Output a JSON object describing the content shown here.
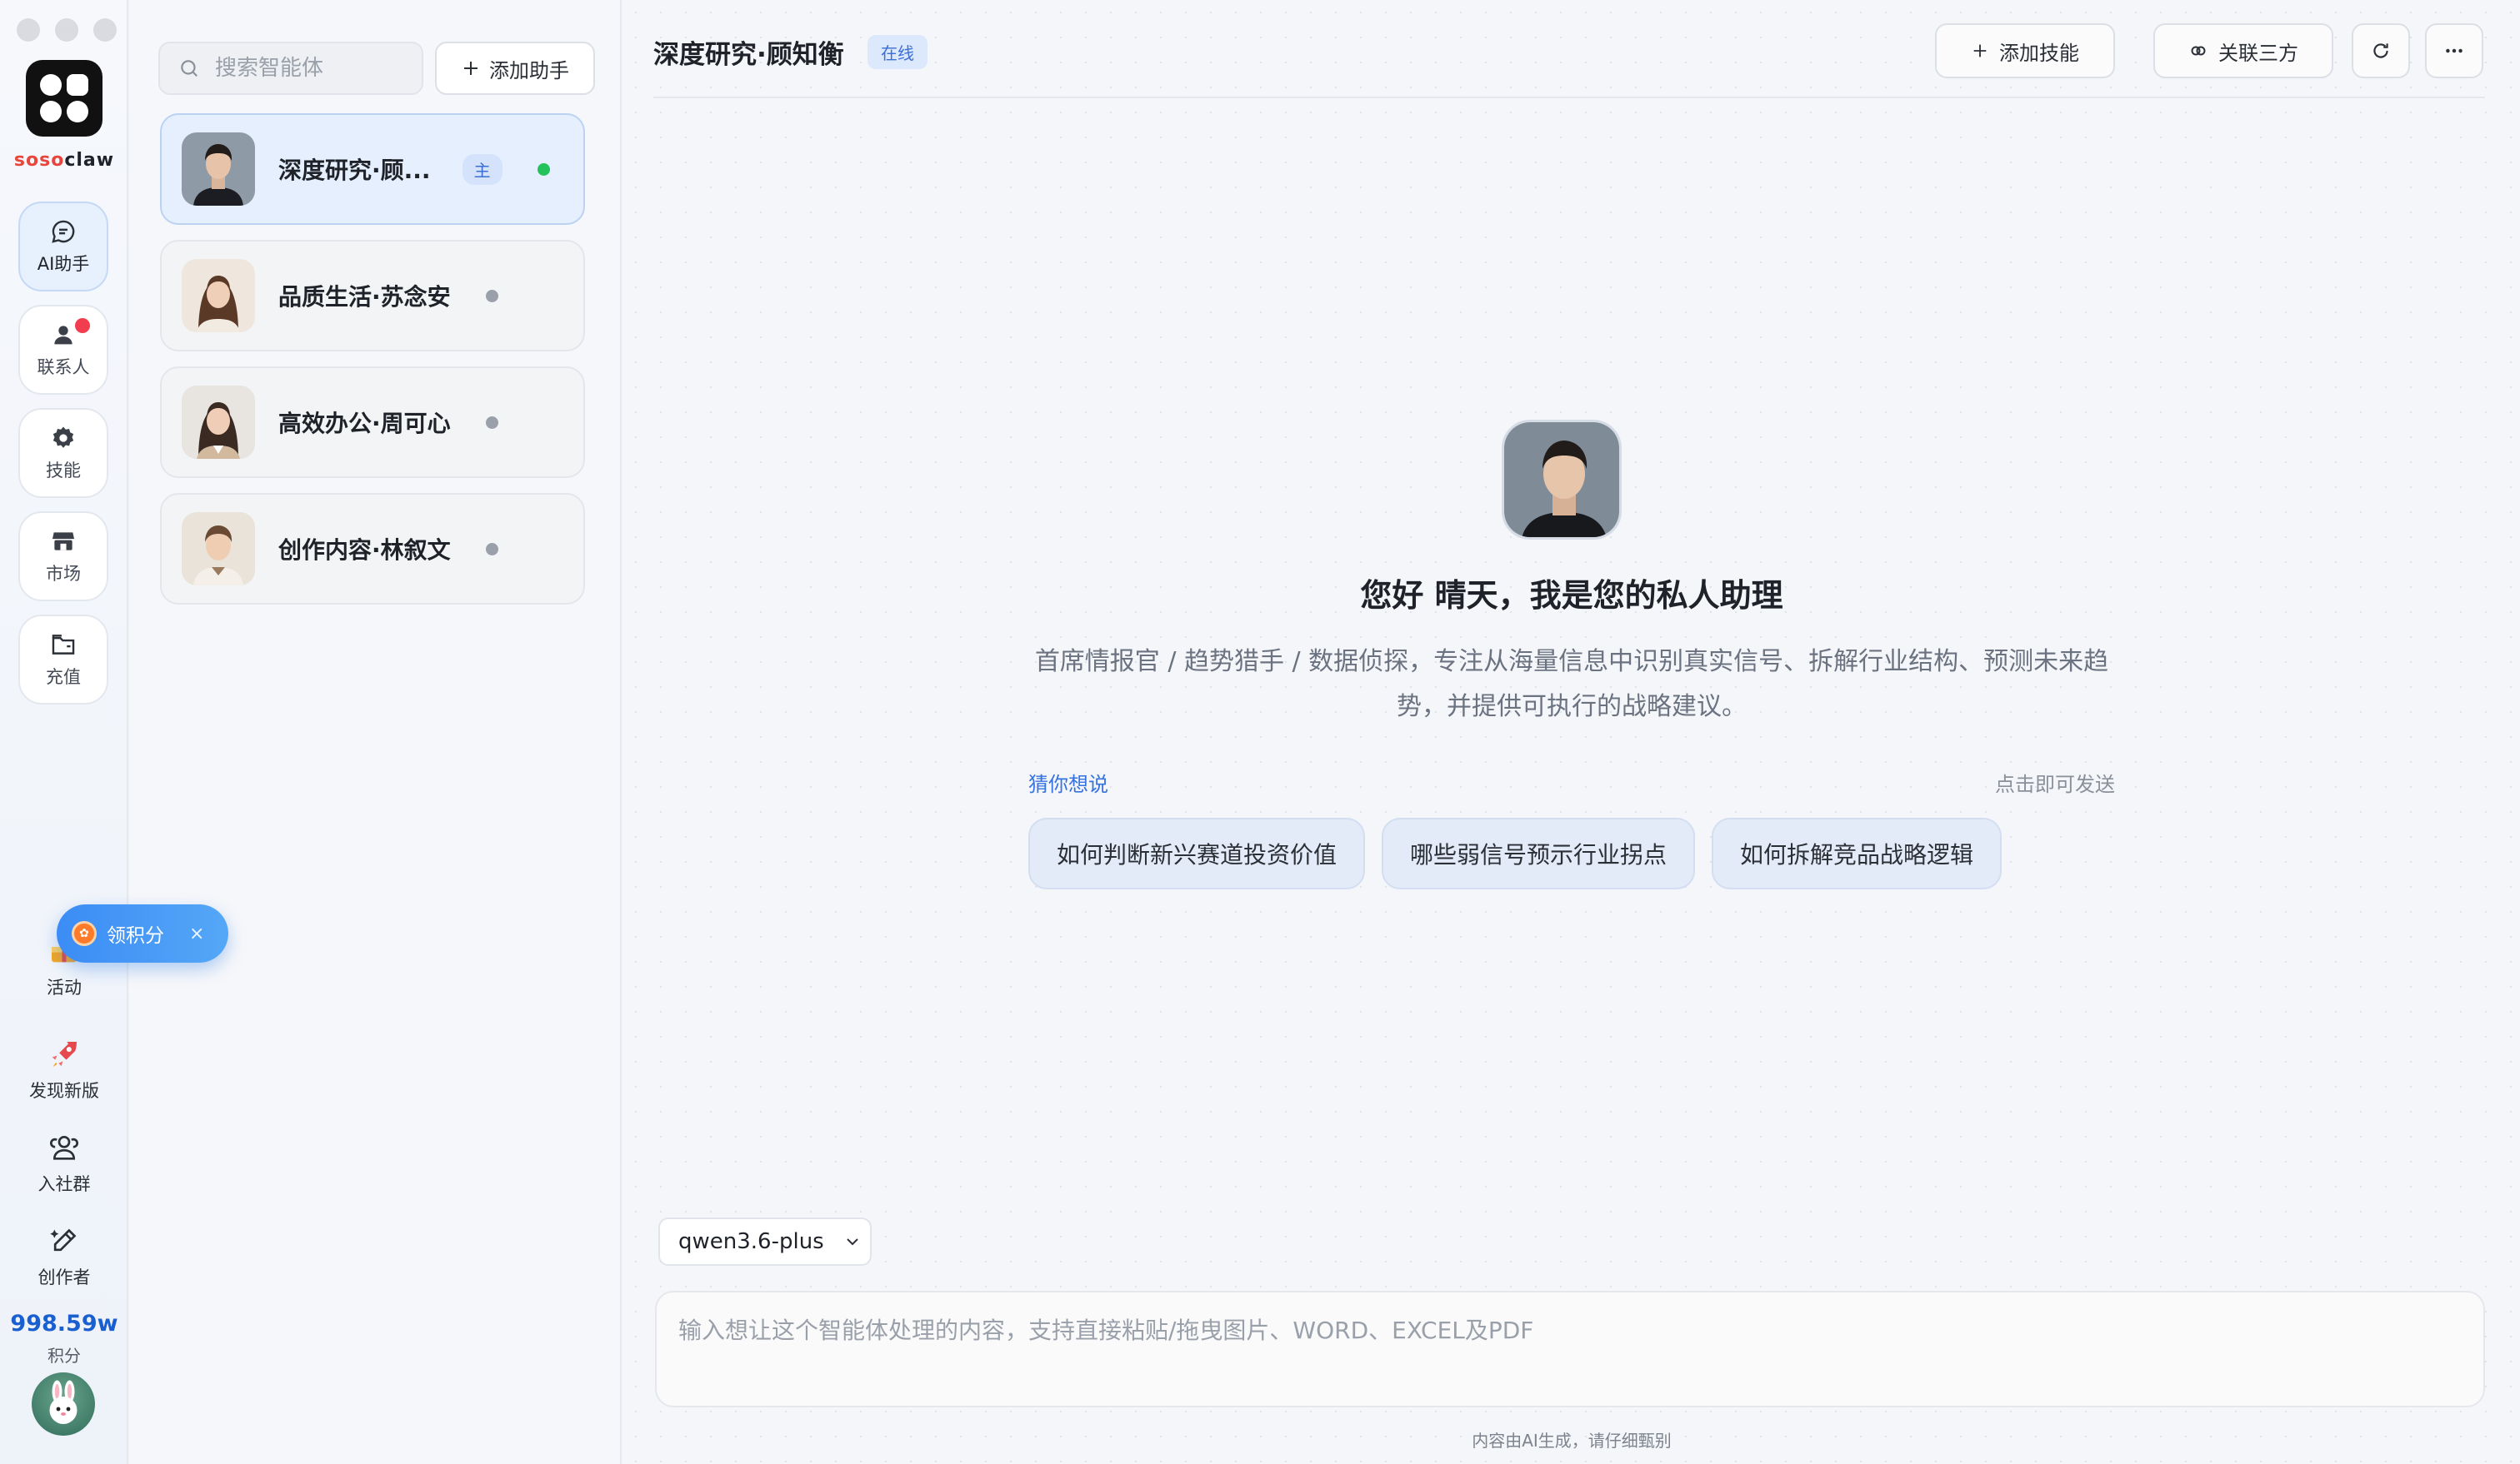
{
  "brand": {
    "logo_part1": "soso",
    "logo_part2": "claw"
  },
  "rail": {
    "items": [
      {
        "label": "AI助手",
        "icon": "chat-icon",
        "active": true
      },
      {
        "label": "联系人",
        "icon": "user-icon",
        "badge": true
      },
      {
        "label": "技能",
        "icon": "gear-icon"
      },
      {
        "label": "市场",
        "icon": "store-icon"
      },
      {
        "label": "充值",
        "icon": "wallet-icon"
      }
    ],
    "bottom": [
      {
        "label": "活动",
        "icon": "gift-icon"
      },
      {
        "label": "发现新版",
        "icon": "rocket-icon"
      },
      {
        "label": "入社群",
        "icon": "group-icon"
      },
      {
        "label": "创作者",
        "icon": "pen-icon"
      }
    ],
    "points_value": "998.59w",
    "points_label": "积分",
    "reward_label": "领积分",
    "reward_close": "×"
  },
  "sidebar": {
    "search_placeholder": "搜索智能体",
    "add_label": "添加助手",
    "agents": [
      {
        "name": "深度研究·顾...",
        "tag": "主",
        "online": true,
        "active": true
      },
      {
        "name": "品质生活·苏念安",
        "online": false
      },
      {
        "name": "高效办公·周可心",
        "online": false
      },
      {
        "name": "创作内容·林叙文",
        "online": false
      }
    ]
  },
  "header": {
    "title": "深度研究·顾知衡",
    "status": "在线",
    "add_skill": "添加技能",
    "link_third": "关联三方",
    "refresh_icon": "refresh-icon",
    "more_icon": "more-icon"
  },
  "welcome": {
    "title": "您好 晴天，我是您的私人助理",
    "desc": "首席情报官 / 趋势猎手 / 数据侦探，专注从海量信息中识别真实信号、拆解行业结构、预测未来趋势，并提供可执行的战略建议。",
    "guess_label": "猜你想说",
    "guess_hint": "点击即可发送",
    "suggestions": [
      "如何判断新兴赛道投资价值",
      "哪些弱信号预示行业拐点",
      "如何拆解竞品战略逻辑"
    ]
  },
  "composer": {
    "model": "qwen3.6-plus",
    "placeholder": "输入想让这个智能体处理的内容，支持直接粘贴/拖曳图片、WORD、EXCEL及PDF",
    "disclaimer": "内容由AI生成，请仔细甄别"
  },
  "colors": {
    "accent": "#3573e0",
    "online": "#23c25b",
    "badge": "#f23d4f",
    "brand_red": "#e8453c"
  }
}
